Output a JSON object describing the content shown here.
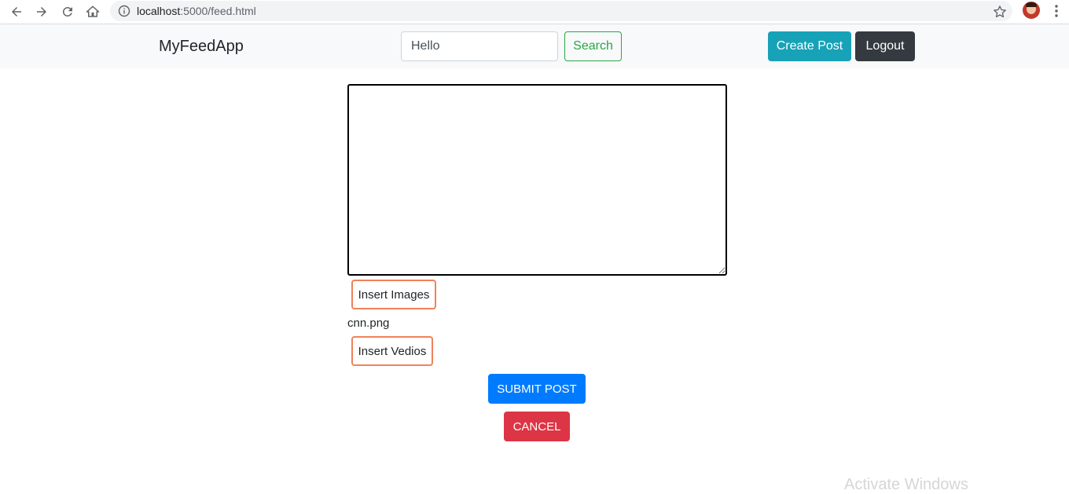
{
  "browser": {
    "url_host": "localhost",
    "url_rest": ":5000/feed.html",
    "icons": [
      "back-arrow-icon",
      "forward-arrow-icon",
      "reload-icon",
      "home-icon",
      "info-icon",
      "star-icon",
      "avatar",
      "kebab-menu-icon"
    ]
  },
  "navbar": {
    "brand": "MyFeedApp",
    "search_value": "Hello",
    "search_button": "Search",
    "create_post_button": "Create Post",
    "logout_button": "Logout"
  },
  "editor": {
    "textarea_value": "",
    "insert_images_button": "Insert Images",
    "attached_file": "cnn.png",
    "insert_videos_button": "Insert Vedios",
    "submit_button": "SUBMIT POST",
    "cancel_button": "CANCEL"
  },
  "os": {
    "watermark": "Activate Windows"
  },
  "colors": {
    "success": "#28a745",
    "info": "#17a2b8",
    "dark": "#343a40",
    "primary": "#007bff",
    "danger": "#dc3545",
    "orange_outline": "#f0825a"
  }
}
